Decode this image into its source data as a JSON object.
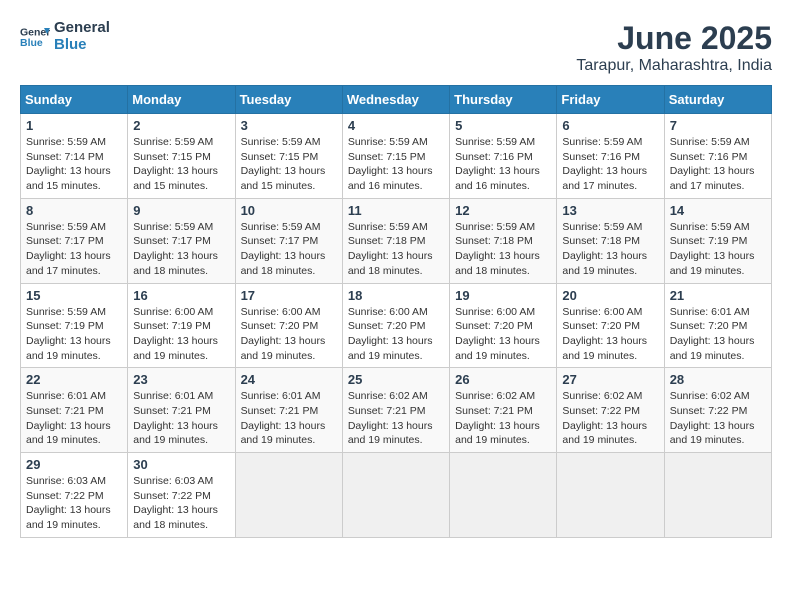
{
  "logo": {
    "text_general": "General",
    "text_blue": "Blue"
  },
  "title": "June 2025",
  "subtitle": "Tarapur, Maharashtra, India",
  "days_of_week": [
    "Sunday",
    "Monday",
    "Tuesday",
    "Wednesday",
    "Thursday",
    "Friday",
    "Saturday"
  ],
  "weeks": [
    [
      {
        "day": "1",
        "sunrise": "5:59 AM",
        "sunset": "7:14 PM",
        "daylight": "13 hours and 15 minutes."
      },
      {
        "day": "2",
        "sunrise": "5:59 AM",
        "sunset": "7:15 PM",
        "daylight": "13 hours and 15 minutes."
      },
      {
        "day": "3",
        "sunrise": "5:59 AM",
        "sunset": "7:15 PM",
        "daylight": "13 hours and 15 minutes."
      },
      {
        "day": "4",
        "sunrise": "5:59 AM",
        "sunset": "7:15 PM",
        "daylight": "13 hours and 16 minutes."
      },
      {
        "day": "5",
        "sunrise": "5:59 AM",
        "sunset": "7:16 PM",
        "daylight": "13 hours and 16 minutes."
      },
      {
        "day": "6",
        "sunrise": "5:59 AM",
        "sunset": "7:16 PM",
        "daylight": "13 hours and 17 minutes."
      },
      {
        "day": "7",
        "sunrise": "5:59 AM",
        "sunset": "7:16 PM",
        "daylight": "13 hours and 17 minutes."
      }
    ],
    [
      {
        "day": "8",
        "sunrise": "5:59 AM",
        "sunset": "7:17 PM",
        "daylight": "13 hours and 17 minutes."
      },
      {
        "day": "9",
        "sunrise": "5:59 AM",
        "sunset": "7:17 PM",
        "daylight": "13 hours and 18 minutes."
      },
      {
        "day": "10",
        "sunrise": "5:59 AM",
        "sunset": "7:17 PM",
        "daylight": "13 hours and 18 minutes."
      },
      {
        "day": "11",
        "sunrise": "5:59 AM",
        "sunset": "7:18 PM",
        "daylight": "13 hours and 18 minutes."
      },
      {
        "day": "12",
        "sunrise": "5:59 AM",
        "sunset": "7:18 PM",
        "daylight": "13 hours and 18 minutes."
      },
      {
        "day": "13",
        "sunrise": "5:59 AM",
        "sunset": "7:18 PM",
        "daylight": "13 hours and 19 minutes."
      },
      {
        "day": "14",
        "sunrise": "5:59 AM",
        "sunset": "7:19 PM",
        "daylight": "13 hours and 19 minutes."
      }
    ],
    [
      {
        "day": "15",
        "sunrise": "5:59 AM",
        "sunset": "7:19 PM",
        "daylight": "13 hours and 19 minutes."
      },
      {
        "day": "16",
        "sunrise": "6:00 AM",
        "sunset": "7:19 PM",
        "daylight": "13 hours and 19 minutes."
      },
      {
        "day": "17",
        "sunrise": "6:00 AM",
        "sunset": "7:20 PM",
        "daylight": "13 hours and 19 minutes."
      },
      {
        "day": "18",
        "sunrise": "6:00 AM",
        "sunset": "7:20 PM",
        "daylight": "13 hours and 19 minutes."
      },
      {
        "day": "19",
        "sunrise": "6:00 AM",
        "sunset": "7:20 PM",
        "daylight": "13 hours and 19 minutes."
      },
      {
        "day": "20",
        "sunrise": "6:00 AM",
        "sunset": "7:20 PM",
        "daylight": "13 hours and 19 minutes."
      },
      {
        "day": "21",
        "sunrise": "6:01 AM",
        "sunset": "7:20 PM",
        "daylight": "13 hours and 19 minutes."
      }
    ],
    [
      {
        "day": "22",
        "sunrise": "6:01 AM",
        "sunset": "7:21 PM",
        "daylight": "13 hours and 19 minutes."
      },
      {
        "day": "23",
        "sunrise": "6:01 AM",
        "sunset": "7:21 PM",
        "daylight": "13 hours and 19 minutes."
      },
      {
        "day": "24",
        "sunrise": "6:01 AM",
        "sunset": "7:21 PM",
        "daylight": "13 hours and 19 minutes."
      },
      {
        "day": "25",
        "sunrise": "6:02 AM",
        "sunset": "7:21 PM",
        "daylight": "13 hours and 19 minutes."
      },
      {
        "day": "26",
        "sunrise": "6:02 AM",
        "sunset": "7:21 PM",
        "daylight": "13 hours and 19 minutes."
      },
      {
        "day": "27",
        "sunrise": "6:02 AM",
        "sunset": "7:22 PM",
        "daylight": "13 hours and 19 minutes."
      },
      {
        "day": "28",
        "sunrise": "6:02 AM",
        "sunset": "7:22 PM",
        "daylight": "13 hours and 19 minutes."
      }
    ],
    [
      {
        "day": "29",
        "sunrise": "6:03 AM",
        "sunset": "7:22 PM",
        "daylight": "13 hours and 19 minutes."
      },
      {
        "day": "30",
        "sunrise": "6:03 AM",
        "sunset": "7:22 PM",
        "daylight": "13 hours and 18 minutes."
      },
      null,
      null,
      null,
      null,
      null
    ]
  ]
}
